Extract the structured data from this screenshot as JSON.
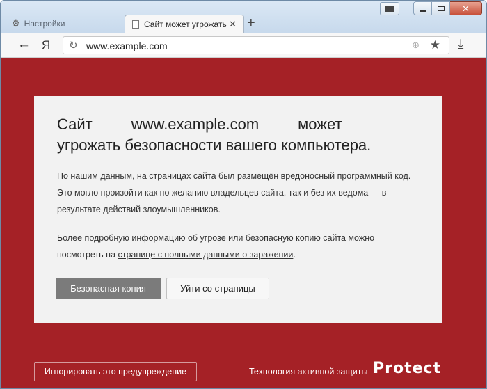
{
  "tabs": [
    {
      "label": "Настройки",
      "icon": "gear-icon",
      "active": false
    },
    {
      "label": "Сайт может угрожать",
      "icon": "page-icon",
      "active": true
    }
  ],
  "toolbar": {
    "back_icon": "←",
    "yandex_label": "Я",
    "url": "www.example.com"
  },
  "warning": {
    "heading_prefix": "Сайт",
    "heading_domain": "www.example.com",
    "heading_suffix": "может",
    "heading_line2": "угрожать безопасности вашего компьютера.",
    "paragraph1": "По нашим данным, на страницах сайта был размещён вредоносный программный код. Это могло произойти как по желанию владельцев сайта, так и без их ведома — в результате действий злоумышленников.",
    "paragraph2_text": "Более подробную информацию об угрозе или безопасную копию сайта можно посмотреть на ",
    "paragraph2_link": "странице с полными данными о заражении",
    "paragraph2_end": ".",
    "safe_copy_button": "Безопасная копия",
    "leave_button": "Уйти со страницы"
  },
  "footer": {
    "ignore_button": "Игнорировать это предупреждение",
    "tech_label": "Технология активной защиты",
    "logo": "Protect"
  },
  "colors": {
    "page_background": "#a52126",
    "card_background": "#f2f2f2",
    "primary_button": "#7b7b7b"
  }
}
